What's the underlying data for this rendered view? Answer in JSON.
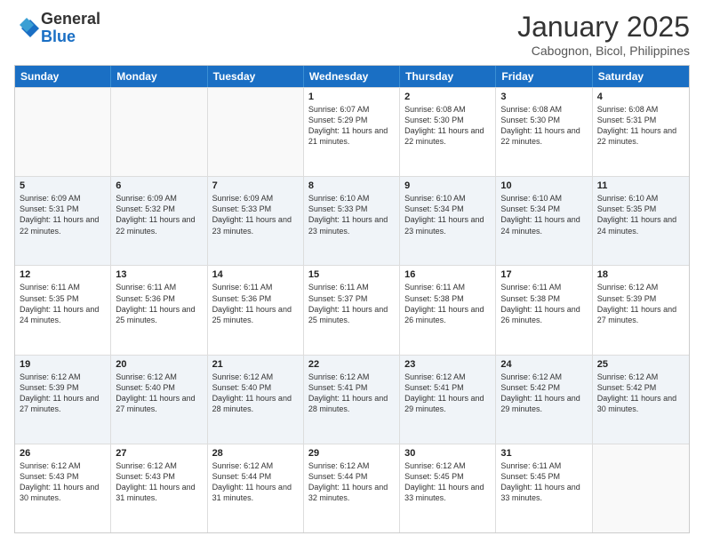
{
  "logo": {
    "general": "General",
    "blue": "Blue"
  },
  "title": "January 2025",
  "subtitle": "Cabognon, Bicol, Philippines",
  "days": [
    "Sunday",
    "Monday",
    "Tuesday",
    "Wednesday",
    "Thursday",
    "Friday",
    "Saturday"
  ],
  "rows": [
    [
      {
        "day": "",
        "info": ""
      },
      {
        "day": "",
        "info": ""
      },
      {
        "day": "",
        "info": ""
      },
      {
        "day": "1",
        "info": "Sunrise: 6:07 AM\nSunset: 5:29 PM\nDaylight: 11 hours and 21 minutes."
      },
      {
        "day": "2",
        "info": "Sunrise: 6:08 AM\nSunset: 5:30 PM\nDaylight: 11 hours and 22 minutes."
      },
      {
        "day": "3",
        "info": "Sunrise: 6:08 AM\nSunset: 5:30 PM\nDaylight: 11 hours and 22 minutes."
      },
      {
        "day": "4",
        "info": "Sunrise: 6:08 AM\nSunset: 5:31 PM\nDaylight: 11 hours and 22 minutes."
      }
    ],
    [
      {
        "day": "5",
        "info": "Sunrise: 6:09 AM\nSunset: 5:31 PM\nDaylight: 11 hours and 22 minutes."
      },
      {
        "day": "6",
        "info": "Sunrise: 6:09 AM\nSunset: 5:32 PM\nDaylight: 11 hours and 22 minutes."
      },
      {
        "day": "7",
        "info": "Sunrise: 6:09 AM\nSunset: 5:33 PM\nDaylight: 11 hours and 23 minutes."
      },
      {
        "day": "8",
        "info": "Sunrise: 6:10 AM\nSunset: 5:33 PM\nDaylight: 11 hours and 23 minutes."
      },
      {
        "day": "9",
        "info": "Sunrise: 6:10 AM\nSunset: 5:34 PM\nDaylight: 11 hours and 23 minutes."
      },
      {
        "day": "10",
        "info": "Sunrise: 6:10 AM\nSunset: 5:34 PM\nDaylight: 11 hours and 24 minutes."
      },
      {
        "day": "11",
        "info": "Sunrise: 6:10 AM\nSunset: 5:35 PM\nDaylight: 11 hours and 24 minutes."
      }
    ],
    [
      {
        "day": "12",
        "info": "Sunrise: 6:11 AM\nSunset: 5:35 PM\nDaylight: 11 hours and 24 minutes."
      },
      {
        "day": "13",
        "info": "Sunrise: 6:11 AM\nSunset: 5:36 PM\nDaylight: 11 hours and 25 minutes."
      },
      {
        "day": "14",
        "info": "Sunrise: 6:11 AM\nSunset: 5:36 PM\nDaylight: 11 hours and 25 minutes."
      },
      {
        "day": "15",
        "info": "Sunrise: 6:11 AM\nSunset: 5:37 PM\nDaylight: 11 hours and 25 minutes."
      },
      {
        "day": "16",
        "info": "Sunrise: 6:11 AM\nSunset: 5:38 PM\nDaylight: 11 hours and 26 minutes."
      },
      {
        "day": "17",
        "info": "Sunrise: 6:11 AM\nSunset: 5:38 PM\nDaylight: 11 hours and 26 minutes."
      },
      {
        "day": "18",
        "info": "Sunrise: 6:12 AM\nSunset: 5:39 PM\nDaylight: 11 hours and 27 minutes."
      }
    ],
    [
      {
        "day": "19",
        "info": "Sunrise: 6:12 AM\nSunset: 5:39 PM\nDaylight: 11 hours and 27 minutes."
      },
      {
        "day": "20",
        "info": "Sunrise: 6:12 AM\nSunset: 5:40 PM\nDaylight: 11 hours and 27 minutes."
      },
      {
        "day": "21",
        "info": "Sunrise: 6:12 AM\nSunset: 5:40 PM\nDaylight: 11 hours and 28 minutes."
      },
      {
        "day": "22",
        "info": "Sunrise: 6:12 AM\nSunset: 5:41 PM\nDaylight: 11 hours and 28 minutes."
      },
      {
        "day": "23",
        "info": "Sunrise: 6:12 AM\nSunset: 5:41 PM\nDaylight: 11 hours and 29 minutes."
      },
      {
        "day": "24",
        "info": "Sunrise: 6:12 AM\nSunset: 5:42 PM\nDaylight: 11 hours and 29 minutes."
      },
      {
        "day": "25",
        "info": "Sunrise: 6:12 AM\nSunset: 5:42 PM\nDaylight: 11 hours and 30 minutes."
      }
    ],
    [
      {
        "day": "26",
        "info": "Sunrise: 6:12 AM\nSunset: 5:43 PM\nDaylight: 11 hours and 30 minutes."
      },
      {
        "day": "27",
        "info": "Sunrise: 6:12 AM\nSunset: 5:43 PM\nDaylight: 11 hours and 31 minutes."
      },
      {
        "day": "28",
        "info": "Sunrise: 6:12 AM\nSunset: 5:44 PM\nDaylight: 11 hours and 31 minutes."
      },
      {
        "day": "29",
        "info": "Sunrise: 6:12 AM\nSunset: 5:44 PM\nDaylight: 11 hours and 32 minutes."
      },
      {
        "day": "30",
        "info": "Sunrise: 6:12 AM\nSunset: 5:45 PM\nDaylight: 11 hours and 33 minutes."
      },
      {
        "day": "31",
        "info": "Sunrise: 6:11 AM\nSunset: 5:45 PM\nDaylight: 11 hours and 33 minutes."
      },
      {
        "day": "",
        "info": ""
      }
    ]
  ]
}
